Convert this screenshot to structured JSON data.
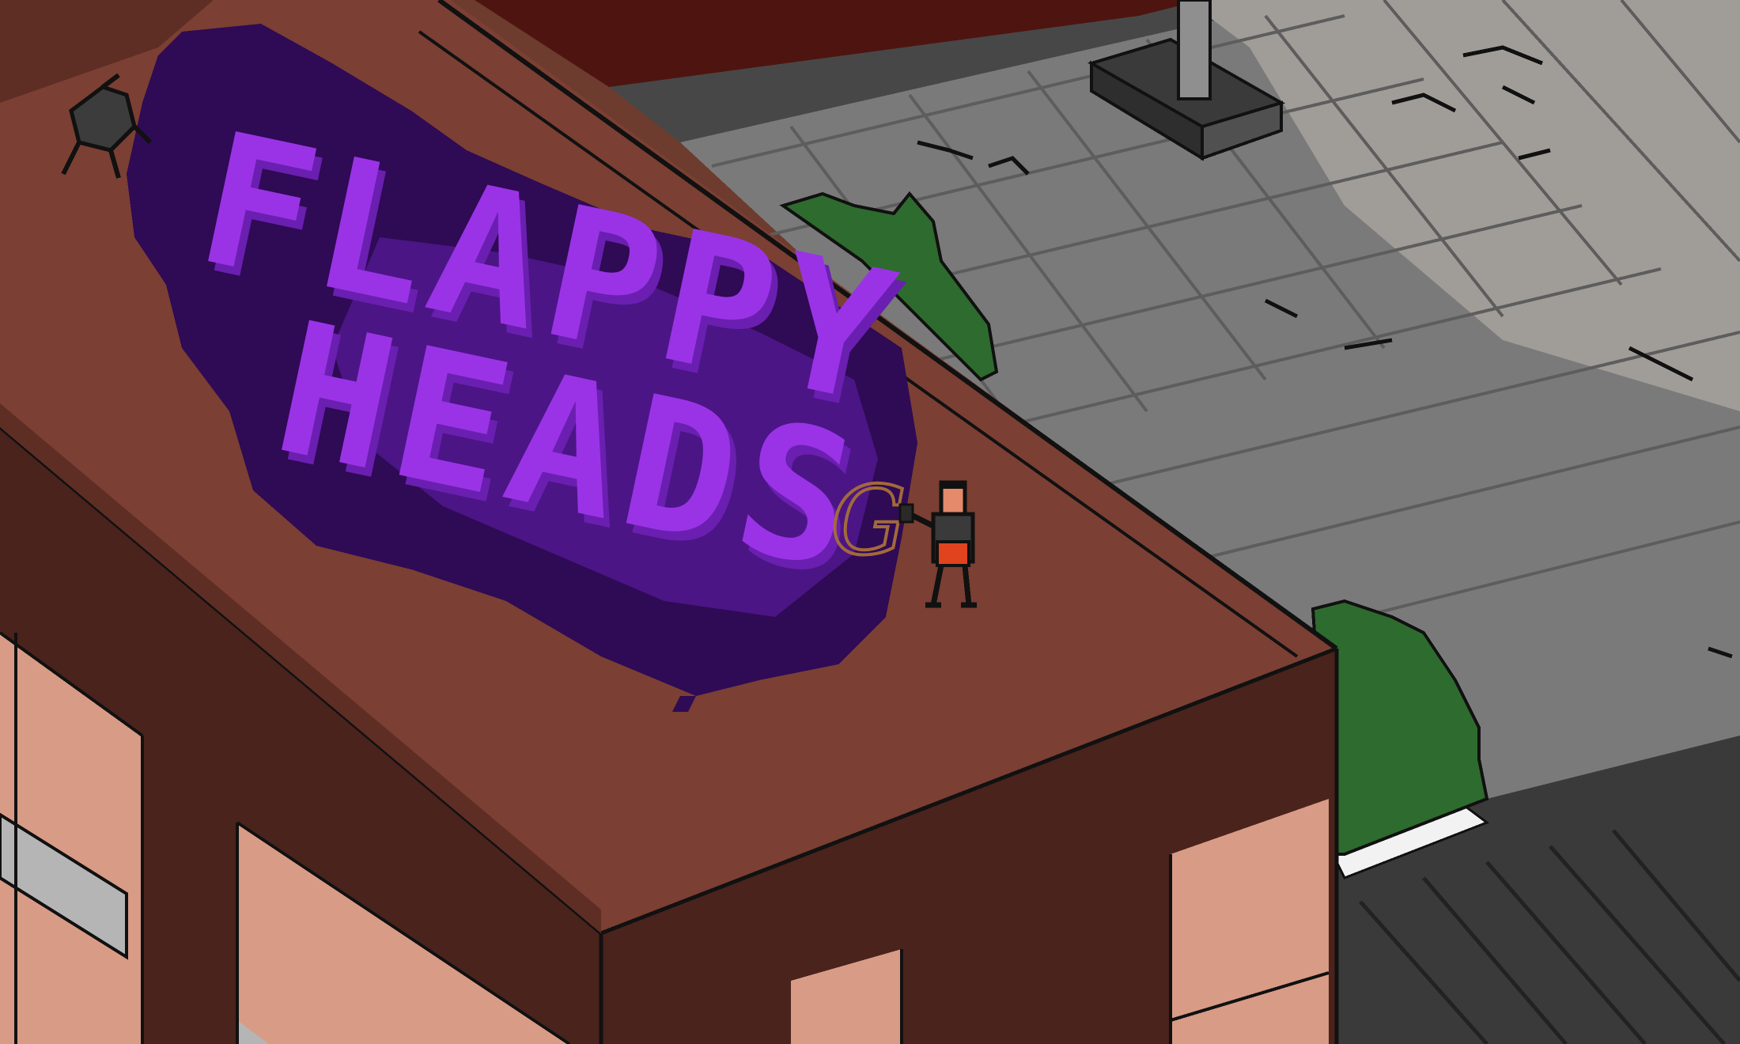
{
  "scene": {
    "graffiti": {
      "line1": "FLAPPY",
      "line2": "HEADS",
      "tag": "G",
      "cloud_color": "#2f0a55",
      "cloud_mid_color": "#4b1585",
      "letter_color": "#9a33e6",
      "letter_shadow_color": "#6a1fb0"
    },
    "colors": {
      "roof_top": "#7b3f33",
      "roof_side": "#4a231c",
      "roof_front": "#5e2e25",
      "roof_dark_stripe": "#4e1510",
      "brick": "#d89b86",
      "window_gray": "#b5b5b5",
      "sidewalk_dark": "#5a5a5a",
      "sidewalk_mid": "#777777",
      "sidewalk_light": "#9a9a9a",
      "street": "#3a3a3a",
      "grass": "#2e6b2e",
      "character_skin": "#e58a6a",
      "character_shirt": "#3a3a3a",
      "character_shorts": "#e0431d",
      "spider": "#3c3c3c"
    },
    "entities": [
      "spider-critter",
      "player-character",
      "spray-can",
      "graffiti-mural",
      "lamp-post-base",
      "grass-patch-upper",
      "grass-patch-lower"
    ]
  }
}
